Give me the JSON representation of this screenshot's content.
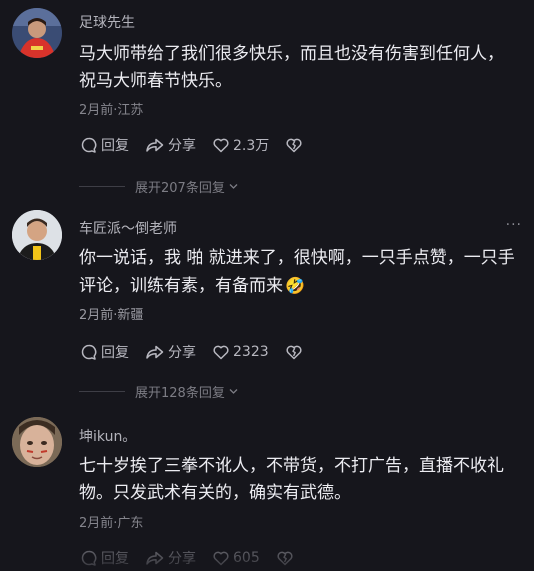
{
  "comments": [
    {
      "author": "足球先生",
      "text_line1": "马大师带给了我们很多快乐，而且也没有伤害到任何人，",
      "text_line2": "祝马大师春节快乐。",
      "meta": "2月前·江苏",
      "reply_label": "回复",
      "share_label": "分享",
      "like_count": "2.3万",
      "expand_label": "展开207条回复"
    },
    {
      "author": "车匠派～倒老师",
      "more": "···",
      "text_line1": "你一说话，我 啪 就进来了，很快啊，一只手点赞，一只手",
      "text_line2": "评论，训练有素，有备而来",
      "emoji": "🤣",
      "meta": "2月前·新疆",
      "reply_label": "回复",
      "share_label": "分享",
      "like_count": "2323",
      "expand_label": "展开128条回复"
    },
    {
      "author": "坤ikun。",
      "text_line1": "七十岁挨了三拳不讹人，不带货，不打广告，直播不收礼",
      "text_line2": "物。只发武术有关的，确实有武德。",
      "meta": "2月前·广东",
      "reply_label": "回复",
      "share_label": "分享",
      "like_count": "605"
    }
  ],
  "icons": {
    "reply": "chat-bubble-icon",
    "share": "share-arrow-icon",
    "like": "heart-icon",
    "dislike": "broken-heart-icon",
    "expand": "chevron-down-icon"
  },
  "colors": {
    "background": "#16161c",
    "text": "#ececf1",
    "secondary": "#85858d"
  }
}
